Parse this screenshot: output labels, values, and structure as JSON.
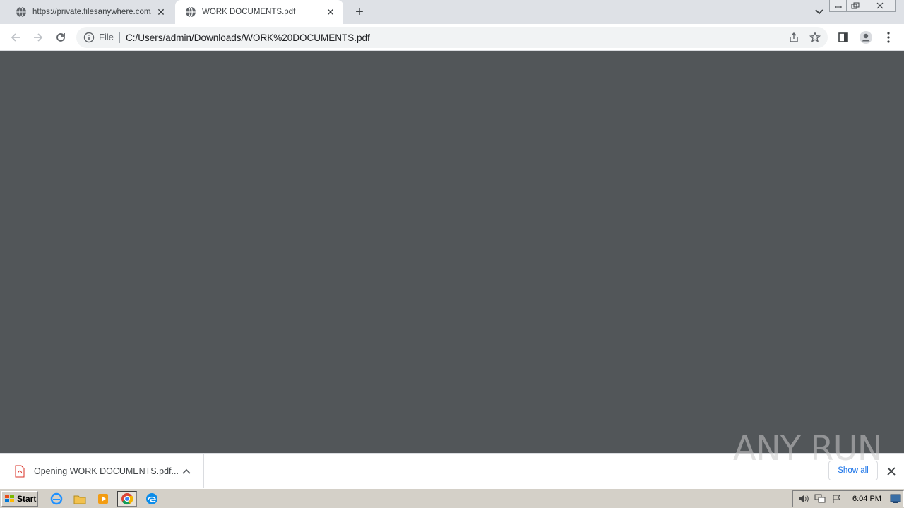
{
  "browser": {
    "tabs": [
      {
        "title": "https://private.filesanywhere.com/g",
        "active": false
      },
      {
        "title": "WORK DOCUMENTS.pdf",
        "active": true
      }
    ],
    "omnibox": {
      "scheme_label": "File",
      "url": "C:/Users/admin/Downloads/WORK%20DOCUMENTS.pdf"
    }
  },
  "download_shelf": {
    "item_label": "Opening WORK DOCUMENTS.pdf...",
    "show_all_label": "Show all"
  },
  "watermark": {
    "text": "ANY RUN"
  },
  "taskbar": {
    "start_label": "Start",
    "clock": "6:04 PM"
  },
  "colors": {
    "pdf_background": "#525659",
    "tabstrip": "#dee1e6",
    "accent_link": "#1a73e8"
  }
}
